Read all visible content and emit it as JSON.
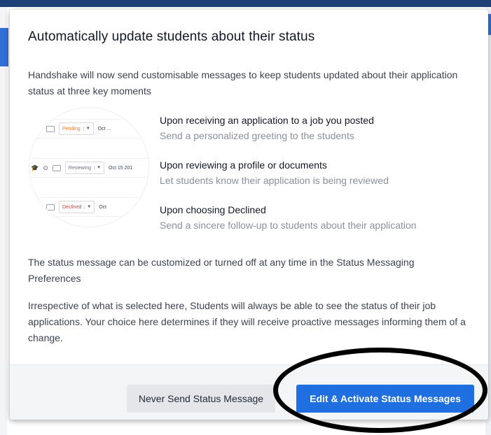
{
  "modal": {
    "title": "Automatically update students about their status",
    "intro": "Handshake will now send customisable messages to keep students updated about their application status at three key moments"
  },
  "illustration": {
    "rows": [
      {
        "status": "Pending",
        "date": "Oct ..."
      },
      {
        "status": "Reviewing",
        "date": "Oct 15 201"
      },
      {
        "status": "Declined",
        "date": "Oct "
      }
    ]
  },
  "moments": [
    {
      "title": "Upon receiving an application to a job you posted",
      "description": "Send a personalized greeting to the students"
    },
    {
      "title": "Upon reviewing a profile or documents",
      "description": "Let students know their application is being reviewed"
    },
    {
      "title": "Upon choosing Declined",
      "description": "Send a sincere follow-up to students about their application"
    }
  ],
  "paragraphs": {
    "customize": "The status message can be customized or turned off at any time in the Status Messaging Preferences",
    "irrespective": "Irrespective of what is selected here, Students will always be able to see the status of their job applications. Your choice here determines if they will receive proactive messages informing them of a change."
  },
  "footer": {
    "never_button": "Never Send Status Message",
    "edit_button": "Edit & Activate Status Messages"
  },
  "colors": {
    "primary": "#1f6fe0",
    "pending": "#e47a30",
    "declined": "#d73939",
    "annotation": "#000000"
  },
  "icons": [
    "graduation-cap-icon",
    "circle-arrow-icon",
    "id-card-icon",
    "chevron-down-icon"
  ]
}
